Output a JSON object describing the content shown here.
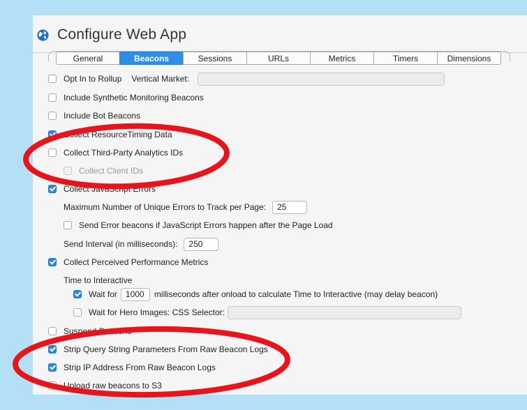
{
  "window": {
    "title": "Configure Web App"
  },
  "tabs": [
    {
      "label": "General",
      "active": false
    },
    {
      "label": "Beacons",
      "active": true
    },
    {
      "label": "Sessions",
      "active": false
    },
    {
      "label": "URLs",
      "active": false
    },
    {
      "label": "Metrics",
      "active": false
    },
    {
      "label": "Timers",
      "active": false
    },
    {
      "label": "Dimensions",
      "active": false
    }
  ],
  "beacons": {
    "opt_in_rollup": {
      "label": "Opt In to Rollup",
      "checked": false
    },
    "vertical_market": {
      "label": "Vertical Market:",
      "value": ""
    },
    "synthetic": {
      "label": "Include Synthetic Monitoring Beacons",
      "checked": false
    },
    "bot": {
      "label": "Include Bot Beacons",
      "checked": false
    },
    "resource_timing": {
      "label": "Collect ResourceTiming Data",
      "checked": true
    },
    "third_party": {
      "label": "Collect Third-Party Analytics IDs",
      "checked": false
    },
    "client_ids": {
      "label": "Collect Client IDs",
      "checked": false,
      "disabled": true
    },
    "js_errors": {
      "label": "Collect JavaScript Errors",
      "checked": true
    },
    "max_errors": {
      "label": "Maximum Number of Unique Errors to Track per Page:",
      "value": "25"
    },
    "send_error": {
      "label": "Send Error beacons if JavaScript Errors happen after the Page Load",
      "checked": false
    },
    "send_interval": {
      "label": "Send Interval (in milliseconds):",
      "value": "250"
    },
    "perceived": {
      "label": "Collect Perceived Performance Metrics",
      "checked": true
    },
    "tti_heading": "Time to Interactive",
    "wait_for": {
      "label_pre": "Wait for",
      "value": "1000",
      "label_post": "milliseconds after onload to calculate Time to Interactive (may delay beacon)",
      "checked": true
    },
    "hero_images": {
      "label": "Wait for Hero Images: CSS Selector:",
      "value": "",
      "checked": false
    },
    "suspend": {
      "label": "Suspend Beacons",
      "checked": false
    },
    "strip_query": {
      "label": "Strip Query String Parameters From Raw Beacon Logs",
      "checked": true
    },
    "strip_ip": {
      "label": "Strip IP Address From Raw Beacon Logs",
      "checked": true
    },
    "upload_s3": {
      "label": "Upload raw beacons to S3",
      "checked": false
    }
  },
  "colors": {
    "accent": "#2f8fe6",
    "annotation": "#e8141c",
    "backdrop": "#b3dff7"
  },
  "icons": {
    "app": "globe-icon"
  }
}
